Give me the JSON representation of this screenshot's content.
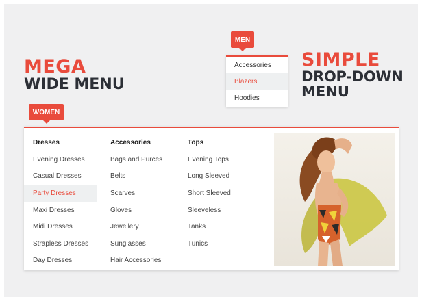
{
  "headings": {
    "mega_line1": "MEGA",
    "mega_line2": "WIDE MENU",
    "simple_line1": "SIMPLE",
    "simple_line2": "DROP-DOWN",
    "simple_line3": "MENU"
  },
  "men_tab": {
    "label": "MEN",
    "items": [
      "Accessories",
      "Blazers",
      "Hoodies"
    ],
    "active_item": "Blazers"
  },
  "women_tab": {
    "label": "WOMEN"
  },
  "mega_menu": {
    "columns": [
      {
        "title": "Dresses",
        "items": [
          "Evening Dresses",
          "Casual Dresses",
          "Party Dresses",
          "Maxi Dresses",
          "Midi Dresses",
          "Strapless Dresses",
          "Day Dresses"
        ]
      },
      {
        "title": "Accessories",
        "items": [
          "Bags and Purces",
          "Belts",
          "Scarves",
          "Gloves",
          "Jewellery",
          "Sunglasses",
          "Hair Accessories"
        ]
      },
      {
        "title": "Tops",
        "items": [
          "Evening Tops",
          "Long Sleeved",
          "Short Sleeved",
          "Sleeveless",
          "Tanks",
          "Tunics"
        ]
      }
    ],
    "active_item": "Party Dresses",
    "image": "fashion-model-photo"
  },
  "colors": {
    "accent": "#e94b3c",
    "dark_text": "#2c2f36",
    "background": "#f0f0f1",
    "highlight_row": "#eef0f1"
  }
}
